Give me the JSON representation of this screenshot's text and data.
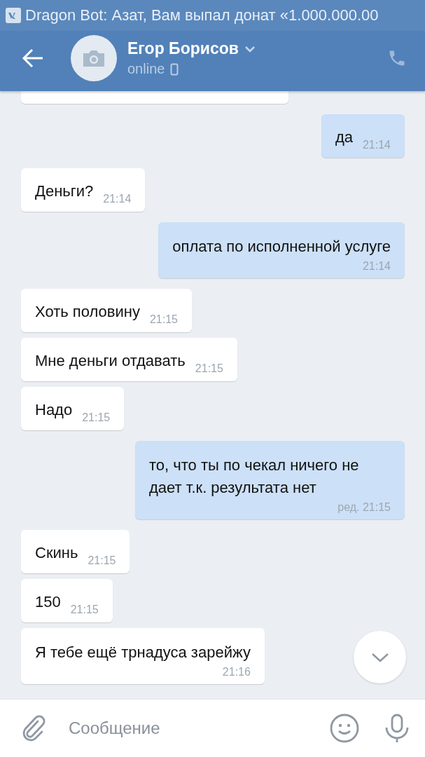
{
  "notification": {
    "text": "Dragon Bot: Азат, Вам выпал донат «1.000.000.00"
  },
  "header": {
    "name": "Егор Борисов",
    "status": "online"
  },
  "messages": [
    {
      "incoming": true,
      "partial": true
    },
    {
      "incoming": false,
      "text": "да",
      "time": "21:14",
      "time_below": false
    },
    {
      "incoming": true,
      "text": "Деньги?",
      "time": "21:14",
      "time_below": false
    },
    {
      "incoming": false,
      "text": "оплата по исполненной услуге",
      "time": "21:14",
      "time_below": true
    },
    {
      "incoming": true,
      "text": "Хоть половину",
      "time": "21:15",
      "time_below": false
    },
    {
      "incoming": true,
      "text": "Мне деньги отдавать",
      "time": "21:15",
      "time_below": false,
      "grouped": true
    },
    {
      "incoming": true,
      "text": "Надо",
      "time": "21:15",
      "time_below": false,
      "grouped": true
    },
    {
      "incoming": false,
      "text": "то, что ты по чекал ничего не дает т.к. результата нет",
      "time": "ред. 21:15",
      "time_below": true
    },
    {
      "incoming": true,
      "text": "Скинь",
      "time": "21:15",
      "time_below": false
    },
    {
      "incoming": true,
      "text": "150",
      "time": "21:15",
      "time_below": false,
      "grouped": true
    },
    {
      "incoming": true,
      "text": "Я тебе ещё трнадуса зарейжу",
      "time": "21:16",
      "time_below": true,
      "grouped": true
    }
  ],
  "composer": {
    "placeholder": "Сообщение"
  }
}
